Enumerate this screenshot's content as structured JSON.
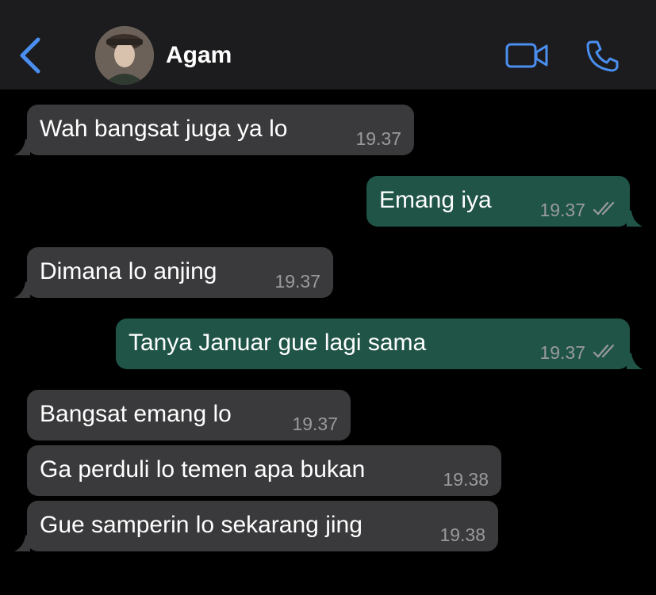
{
  "header": {
    "contact_name": "Agam"
  },
  "messages": [
    {
      "direction": "incoming",
      "text": "Wah bangsat juga ya lo",
      "time": "19.37"
    },
    {
      "direction": "outgoing",
      "text": "Emang iya",
      "time": "19.37",
      "status": "read"
    },
    {
      "direction": "incoming",
      "text": "Dimana lo anjing",
      "time": "19.37"
    },
    {
      "direction": "outgoing",
      "text": "Tanya Januar gue lagi sama",
      "time": "19.37",
      "status": "read"
    },
    {
      "direction": "incoming",
      "text": "Bangsat emang lo",
      "time": "19.37"
    },
    {
      "direction": "incoming",
      "text": "Ga perduli lo temen apa bukan",
      "time": "19.38"
    },
    {
      "direction": "incoming",
      "text": "Gue samperin lo sekarang jing",
      "time": "19.38"
    }
  ],
  "colors": {
    "accent": "#4a8ff0",
    "incoming_bubble": "#3a3a3c",
    "outgoing_bubble": "#1f5447",
    "header_bg": "#1c1c1e",
    "timestamp": "#9a9a9e"
  },
  "icons": [
    "back-chevron-icon",
    "video-call-icon",
    "phone-call-icon",
    "read-ticks-icon"
  ]
}
